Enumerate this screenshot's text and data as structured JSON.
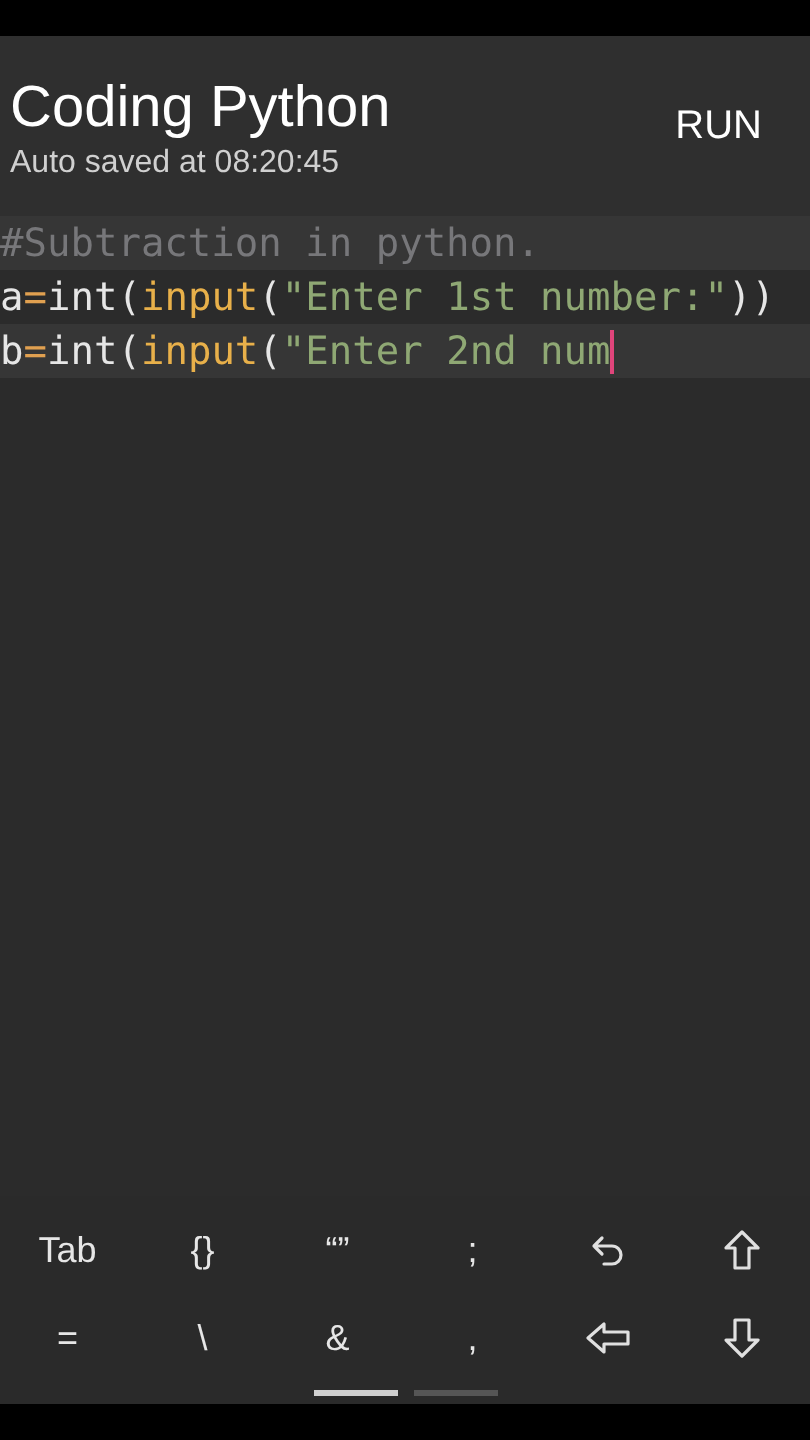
{
  "header": {
    "title": "Coding Python",
    "subtitle": "Auto saved at 08:20:45",
    "action": "RUN"
  },
  "editor": {
    "lines": [
      {
        "highlighted": true,
        "cursor": false,
        "tokens": [
          {
            "kind": "comment",
            "text": "#Subtraction in python."
          }
        ]
      },
      {
        "highlighted": false,
        "cursor": false,
        "tokens": [
          {
            "kind": "plain",
            "text": "a"
          },
          {
            "kind": "operator",
            "text": "="
          },
          {
            "kind": "plain",
            "text": "int("
          },
          {
            "kind": "function",
            "text": "input"
          },
          {
            "kind": "plain",
            "text": "("
          },
          {
            "kind": "string",
            "text": "\"Enter 1st number:\""
          },
          {
            "kind": "plain",
            "text": "))"
          }
        ]
      },
      {
        "highlighted": true,
        "cursor": true,
        "tokens": [
          {
            "kind": "plain",
            "text": "b"
          },
          {
            "kind": "operator",
            "text": "="
          },
          {
            "kind": "plain",
            "text": "int("
          },
          {
            "kind": "function",
            "text": "input"
          },
          {
            "kind": "plain",
            "text": "("
          },
          {
            "kind": "string",
            "text": "\"Enter 2nd num"
          }
        ]
      }
    ]
  },
  "keys": [
    {
      "kind": "text",
      "label": "Tab"
    },
    {
      "kind": "text",
      "label": "{}"
    },
    {
      "kind": "text",
      "label": "“”"
    },
    {
      "kind": "text",
      "label": ";"
    },
    {
      "kind": "undo"
    },
    {
      "kind": "up"
    },
    {
      "kind": "text",
      "label": "="
    },
    {
      "kind": "text",
      "label": "\\"
    },
    {
      "kind": "text",
      "label": "&"
    },
    {
      "kind": "text",
      "label": ","
    },
    {
      "kind": "left"
    },
    {
      "kind": "down"
    }
  ],
  "pages": [
    {
      "selected": true
    },
    {
      "selected": false
    }
  ]
}
